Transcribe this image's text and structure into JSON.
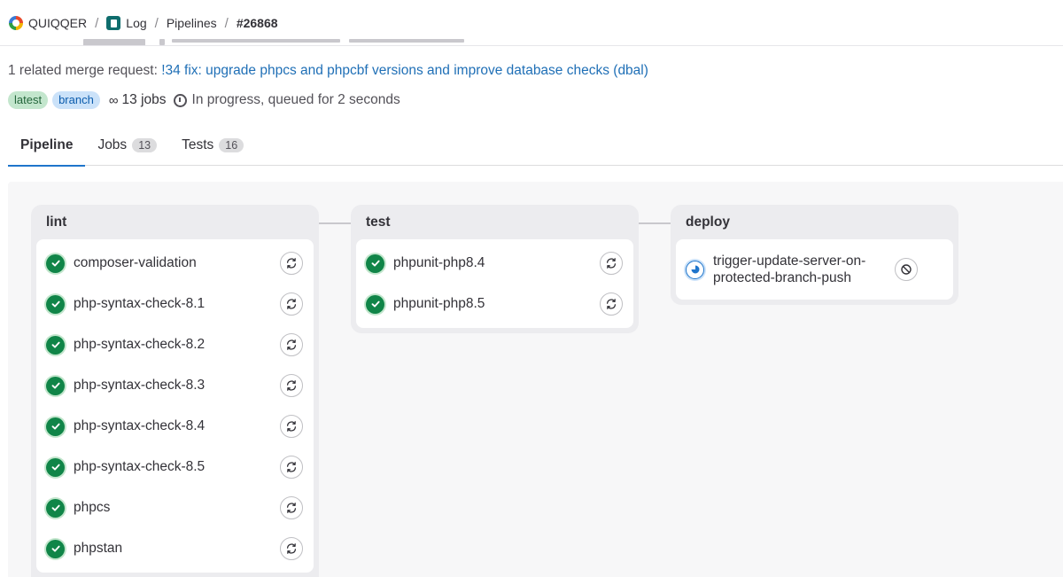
{
  "breadcrumb": {
    "group": "QUIQQER",
    "project": "Log",
    "section": "Pipelines",
    "current": "#26868"
  },
  "merge_request": {
    "prefix": "1 related merge request:",
    "link": "!34 fix: upgrade phpcs and phpcbf versions and improve database checks (dbal)"
  },
  "meta": {
    "badges": [
      "latest",
      "branch"
    ],
    "jobs_label": "13 jobs",
    "status": "In progress, queued for 2 seconds"
  },
  "tabs": [
    {
      "label": "Pipeline",
      "count": ""
    },
    {
      "label": "Jobs",
      "count": "13"
    },
    {
      "label": "Tests",
      "count": "16"
    }
  ],
  "stages": {
    "lint": {
      "title": "lint",
      "jobs": [
        {
          "name": "composer-validation",
          "status": "success",
          "action": "retry"
        },
        {
          "name": "php-syntax-check-8.1",
          "status": "success",
          "action": "retry"
        },
        {
          "name": "php-syntax-check-8.2",
          "status": "success",
          "action": "retry"
        },
        {
          "name": "php-syntax-check-8.3",
          "status": "success",
          "action": "retry"
        },
        {
          "name": "php-syntax-check-8.4",
          "status": "success",
          "action": "retry"
        },
        {
          "name": "php-syntax-check-8.5",
          "status": "success",
          "action": "retry"
        },
        {
          "name": "phpcs",
          "status": "success",
          "action": "retry"
        },
        {
          "name": "phpstan",
          "status": "success",
          "action": "retry"
        }
      ]
    },
    "test": {
      "title": "test",
      "jobs": [
        {
          "name": "phpunit-php8.4",
          "status": "success",
          "action": "retry"
        },
        {
          "name": "phpunit-php8.5",
          "status": "success",
          "action": "retry"
        }
      ]
    },
    "deploy": {
      "title": "deploy",
      "jobs": [
        {
          "name": "trigger-update-server-on-protected-branch-push",
          "status": "running",
          "action": "cancel"
        }
      ]
    }
  },
  "colors": {
    "success": "#108548",
    "link": "#1f6fb6",
    "tab_active": "#1f75cb"
  }
}
